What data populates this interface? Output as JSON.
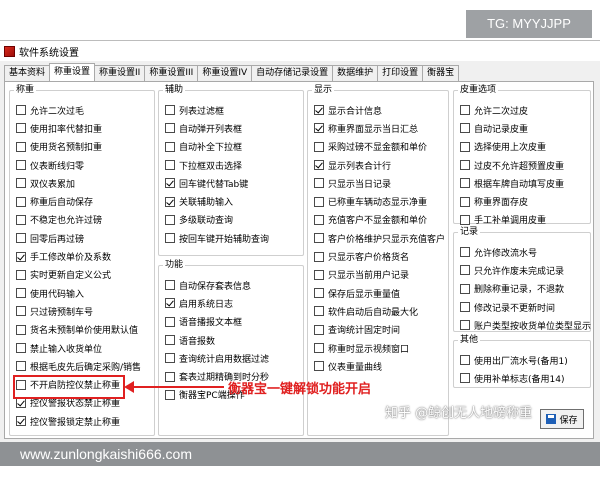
{
  "badge": "TG: MYYJJPP",
  "window": {
    "title": "软件系统设置"
  },
  "tabs": [
    "基本资料",
    "称重设置",
    "称重设置II",
    "称重设置III",
    "称重设置IV",
    "自动存储记录设置",
    "数据维护",
    "打印设置",
    "衡器宝"
  ],
  "active_tab": 1,
  "groups": {
    "weighing": {
      "title": "称重",
      "items": [
        {
          "label": "允许二次过毛",
          "checked": false
        },
        {
          "label": "使用扣率代替扣重",
          "checked": false
        },
        {
          "label": "使用货名预制扣重",
          "checked": false
        },
        {
          "label": "仪表断线归零",
          "checked": false
        },
        {
          "label": "双仪表累加",
          "checked": false
        },
        {
          "label": "称重后自动保存",
          "checked": false
        },
        {
          "label": "不稳定也允许过磅",
          "checked": false
        },
        {
          "label": "回零后再过磅",
          "checked": false
        },
        {
          "label": "手工修改单价及系数",
          "checked": true
        },
        {
          "label": "实时更新自定义公式",
          "checked": false
        },
        {
          "label": "使用代码输入",
          "checked": false
        },
        {
          "label": "只过磅预制车号",
          "checked": false
        },
        {
          "label": "货名未预制单价使用默认值",
          "checked": false
        },
        {
          "label": "禁止输入收货单位",
          "checked": false
        },
        {
          "label": "根据毛皮先后确定采购/销售",
          "checked": false
        },
        {
          "label": "不开启防控仪禁止称重",
          "checked": false
        },
        {
          "label": "控仪警报状态禁止称重",
          "checked": true
        },
        {
          "label": "控仪警报锁定禁止称重",
          "checked": true
        }
      ]
    },
    "assist": {
      "title": "辅助",
      "items": [
        {
          "label": "列表过滤框",
          "checked": false
        },
        {
          "label": "自动弹开列表框",
          "checked": false
        },
        {
          "label": "自动补全下拉框",
          "checked": false
        },
        {
          "label": "下拉框双击选择",
          "checked": false
        },
        {
          "label": "回车键代替Tab键",
          "checked": true
        },
        {
          "label": "关联辅助输入",
          "checked": true
        },
        {
          "label": "多级联动查询",
          "checked": false
        },
        {
          "label": "按回车键开始辅助查询",
          "checked": false
        }
      ]
    },
    "function": {
      "title": "功能",
      "items": [
        {
          "label": "自动保存套表信息",
          "checked": false
        },
        {
          "label": "启用系统日志",
          "checked": true
        },
        {
          "label": "语音播报文本框",
          "checked": false
        },
        {
          "label": "语音报数",
          "checked": false
        },
        {
          "label": "查询统计启用数据过滤",
          "checked": false
        },
        {
          "label": "套表过期精确到时分秒",
          "checked": false
        },
        {
          "label": "衡器宝PC端操作",
          "checked": false
        }
      ]
    },
    "display": {
      "title": "显示",
      "items": [
        {
          "label": "显示合计信息",
          "checked": true
        },
        {
          "label": "称重界面显示当日汇总",
          "checked": true
        },
        {
          "label": "采购过磅不显金额和单价",
          "checked": false
        },
        {
          "label": "显示列表合计行",
          "checked": true
        },
        {
          "label": "只显示当日记录",
          "checked": false
        },
        {
          "label": "已称重车辆动态显示净重",
          "checked": false
        },
        {
          "label": "充值客户不显金额和单价",
          "checked": false
        },
        {
          "label": "客户价格维护只显示充值客户",
          "checked": false
        },
        {
          "label": "只显示客户价格货名",
          "checked": false
        },
        {
          "label": "只显示当前用户记录",
          "checked": false
        },
        {
          "label": "保存后显示重量值",
          "checked": false
        },
        {
          "label": "软件启动后自动最大化",
          "checked": false
        },
        {
          "label": "查询统计固定时间",
          "checked": false
        },
        {
          "label": "称重时显示视频窗口",
          "checked": false
        },
        {
          "label": "仪表重量曲线",
          "checked": false
        }
      ]
    },
    "tare": {
      "title": "皮重选项",
      "items": [
        {
          "label": "允许二次过皮",
          "checked": false
        },
        {
          "label": "自动记录皮重",
          "checked": false
        },
        {
          "label": "选择使用上次皮重",
          "checked": false
        },
        {
          "label": "过皮不允许超预置皮重",
          "checked": false
        },
        {
          "label": "根据车牌自动填写皮重",
          "checked": false
        },
        {
          "label": "称重界面存皮",
          "checked": false
        },
        {
          "label": "手工补单调用皮重",
          "checked": false
        }
      ]
    },
    "record": {
      "title": "记录",
      "items": [
        {
          "label": "允许修改流水号",
          "checked": false
        },
        {
          "label": "只允许作废未完成记录",
          "checked": false
        },
        {
          "label": "删除称重记录，不退款",
          "checked": false
        },
        {
          "label": "修改记录不更新时间",
          "checked": false
        },
        {
          "label": "账户类型按收货单位类型显示",
          "checked": false
        }
      ]
    },
    "other": {
      "title": "其他",
      "items": [
        {
          "label": "使用出厂流水号(备用1)",
          "checked": false
        },
        {
          "label": "使用补单标志(备用14)",
          "checked": false
        }
      ]
    }
  },
  "annotation": "衡器宝一键解锁功能开启",
  "watermark": "知乎 @鲸创无人地磅称重",
  "save_button": "保存",
  "footer_url": "www.zunlongkaishi666.com"
}
